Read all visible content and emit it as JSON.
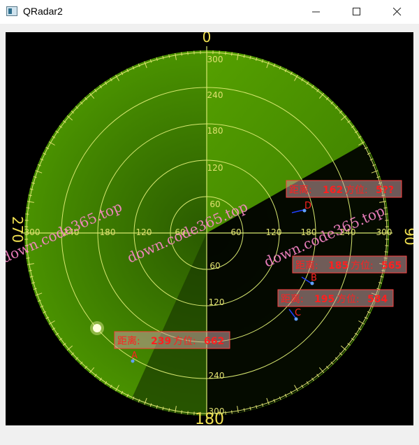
{
  "window": {
    "title": "QRadar2",
    "icons": {
      "app": "app-window-icon",
      "minimize": "minimize-icon",
      "maximize": "maximize-icon",
      "close": "close-icon"
    }
  },
  "radar": {
    "compass": {
      "north": "0",
      "east": "90",
      "south": "180",
      "west": "270"
    },
    "vertical_up_labels": [
      "300",
      "240",
      "180",
      "120",
      "60"
    ],
    "vertical_down_labels": [
      "60",
      "120",
      "240",
      "300"
    ],
    "horizontal_left_labels": [
      "300",
      "240",
      "180",
      "120",
      "60"
    ],
    "horizontal_right_labels": [
      "60",
      "120",
      "180",
      "240",
      "300"
    ],
    "colors": {
      "background": "#000000",
      "green": "#4a9200",
      "grid": "#d8e870",
      "label": "#e0e070",
      "target_text": "#ff2020"
    },
    "targets": [
      {
        "id": "D",
        "info_label": "距离:",
        "distance": "162",
        "bearing_label": "方位:",
        "bearing": "5??"
      },
      {
        "id": "B",
        "info_label": "距离:",
        "distance": "185",
        "bearing_label": "方位:",
        "bearing": "565"
      },
      {
        "id": "C",
        "info_label": "距离:",
        "distance": "195",
        "bearing_label": "方位:",
        "bearing": "584"
      },
      {
        "id": "A",
        "info_label": "距离:",
        "distance": "239",
        "bearing_label": "方位:",
        "bearing": "662"
      }
    ],
    "watermark": "down.code365.top"
  }
}
